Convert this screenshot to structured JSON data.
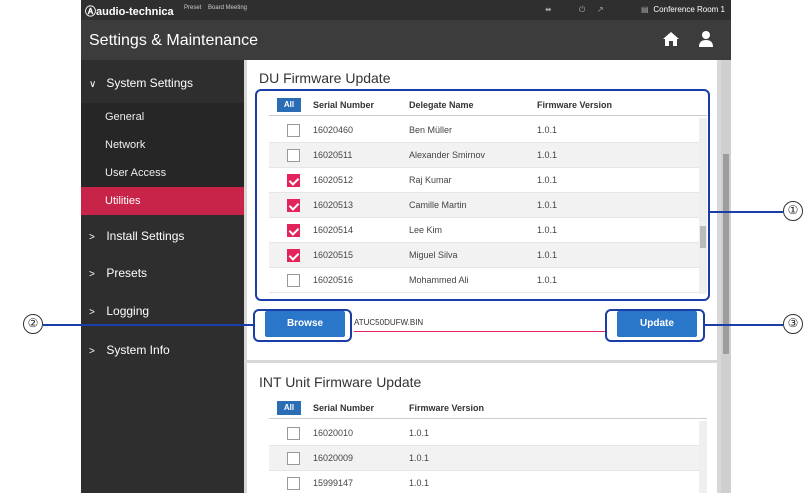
{
  "topbar": {
    "logo": "Ⓐaudio-technica",
    "mode": "Preset",
    "meeting": "Board Meeting",
    "room": "Conference Room 1"
  },
  "header": {
    "title": "Settings & Maintenance"
  },
  "sidebar": {
    "system_settings": "System Settings",
    "sub": [
      "General",
      "Network",
      "User Access",
      "Utilities"
    ],
    "install_settings": "Install Settings",
    "presets": "Presets",
    "logging": "Logging",
    "system_info": "System Info"
  },
  "du": {
    "title": "DU Firmware Update",
    "all": "All",
    "columns": [
      "Serial Number",
      "Delegate Name",
      "Firmware Version"
    ],
    "rows": [
      {
        "serial": "16020460",
        "name": "Ben Müller",
        "version": "1.0.1",
        "checked": false
      },
      {
        "serial": "16020511",
        "name": "Alexander Smirnov",
        "version": "1.0.1",
        "checked": false
      },
      {
        "serial": "16020512",
        "name": "Raj Kumar",
        "version": "1.0.1",
        "checked": true
      },
      {
        "serial": "16020513",
        "name": "Camille Martin",
        "version": "1.0.1",
        "checked": true
      },
      {
        "serial": "16020514",
        "name": "Lee Kim",
        "version": "1.0.1",
        "checked": true
      },
      {
        "serial": "16020515",
        "name": "Miguel Silva",
        "version": "1.0.1",
        "checked": true
      },
      {
        "serial": "16020516",
        "name": "Mohammed Ali",
        "version": "1.0.1",
        "checked": false
      }
    ],
    "browse": "Browse",
    "filename": "ATUC50DUFW.BIN",
    "update": "Update"
  },
  "int": {
    "title": "INT Unit Firmware Update",
    "all": "All",
    "columns": [
      "Serial Number",
      "Firmware Version"
    ],
    "rows": [
      {
        "serial": "16020010",
        "version": "1.0.1"
      },
      {
        "serial": "16020009",
        "version": "1.0.1"
      },
      {
        "serial": "15999147",
        "version": "1.0.1"
      }
    ]
  },
  "callouts": [
    "①",
    "②",
    "③"
  ],
  "colors": {
    "accent": "#c8244a",
    "button": "#2a77c9",
    "highlight": "#1a3ea8"
  }
}
